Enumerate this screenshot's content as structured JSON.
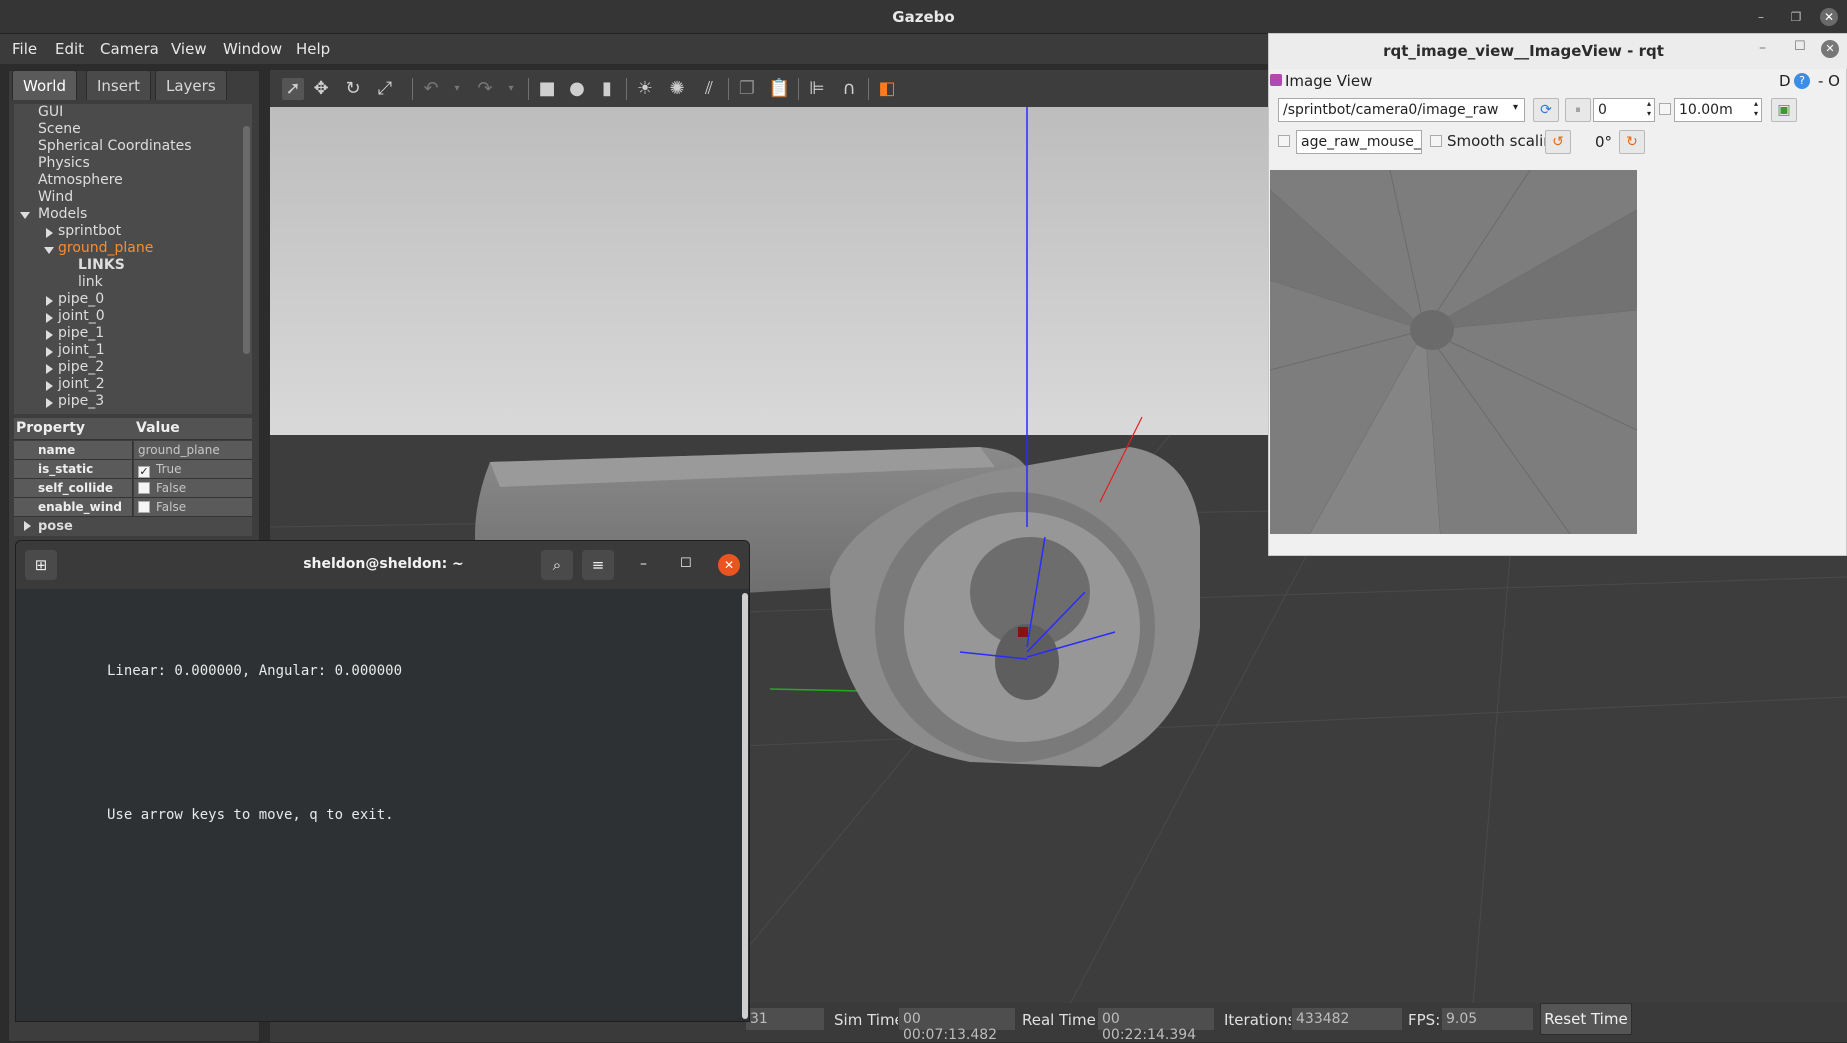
{
  "gazebo": {
    "window_title": "Gazebo",
    "menu": [
      "File",
      "Edit",
      "Camera",
      "View",
      "Window",
      "Help"
    ],
    "tabs": [
      "World",
      "Insert",
      "Layers"
    ],
    "tree": {
      "items": [
        "GUI",
        "Scene",
        "Spherical Coordinates",
        "Physics",
        "Atmosphere",
        "Wind",
        "Models"
      ],
      "models": [
        "sprintbot",
        "ground_plane"
      ],
      "ground_plane_children": [
        "LINKS",
        "link"
      ],
      "more_models": [
        "pipe_0",
        "joint_0",
        "pipe_1",
        "joint_1",
        "pipe_2",
        "joint_2",
        "pipe_3"
      ]
    },
    "properties": {
      "header": {
        "property": "Property",
        "value": "Value"
      },
      "rows": [
        {
          "name": "name",
          "value": "ground_plane"
        },
        {
          "name": "is_static",
          "value": "True",
          "checked": true
        },
        {
          "name": "self_collide",
          "value": "False",
          "checked": false
        },
        {
          "name": "enable_wind",
          "value": "False",
          "checked": false
        }
      ],
      "pose_label": "pose"
    },
    "status": {
      "real_time_factor_value": "31",
      "sim_time_label": "Sim Time:",
      "sim_time": "00 00:07:13.482",
      "real_time_label": "Real Time:",
      "real_time": "00 00:22:14.394",
      "iterations_label": "Iterations:",
      "iterations": "433482",
      "fps_label": "FPS:",
      "fps": "9.05",
      "reset_button": "Reset Time"
    }
  },
  "rqt": {
    "window_title": "rqt_image_view__ImageView - rqt",
    "plugin_title": "Image View",
    "plugin_buttons": "D",
    "topic": "/sprintbot/camera0/image_raw",
    "spin_value": "0",
    "distance": "10.00m",
    "mouse_topic": "age_raw_mouse_left",
    "smooth_label": "Smooth scaling",
    "rotation": "0°"
  },
  "terminal": {
    "title": "sheldon@sheldon: ~",
    "line1": "Linear: 0.000000, Angular: 0.000000",
    "line2": "Use arrow keys to move, q to exit."
  },
  "colors": {
    "selection": "#ff8c2a",
    "z_axis": "#2b2bff",
    "x_axis": "#e02020",
    "y_axis": "#22aa22"
  }
}
